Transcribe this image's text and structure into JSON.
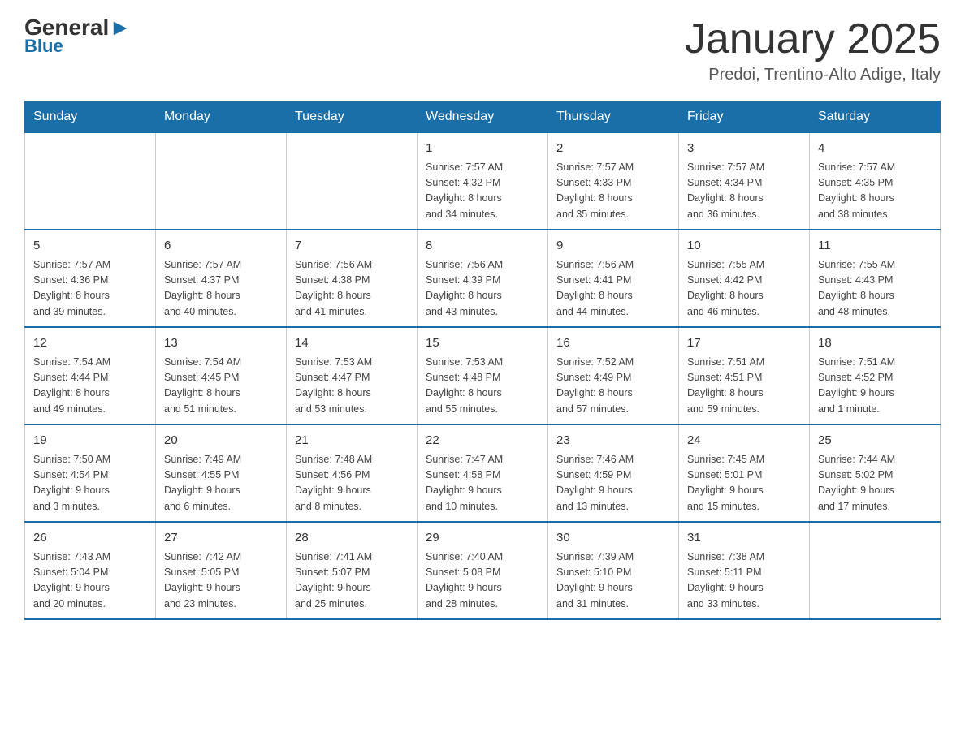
{
  "header": {
    "logo_top": "General",
    "logo_bottom": "Blue",
    "page_title": "January 2025",
    "subtitle": "Predoi, Trentino-Alto Adige, Italy"
  },
  "days_of_week": [
    "Sunday",
    "Monday",
    "Tuesday",
    "Wednesday",
    "Thursday",
    "Friday",
    "Saturday"
  ],
  "weeks": [
    [
      {
        "day": "",
        "info": ""
      },
      {
        "day": "",
        "info": ""
      },
      {
        "day": "",
        "info": ""
      },
      {
        "day": "1",
        "info": "Sunrise: 7:57 AM\nSunset: 4:32 PM\nDaylight: 8 hours\nand 34 minutes."
      },
      {
        "day": "2",
        "info": "Sunrise: 7:57 AM\nSunset: 4:33 PM\nDaylight: 8 hours\nand 35 minutes."
      },
      {
        "day": "3",
        "info": "Sunrise: 7:57 AM\nSunset: 4:34 PM\nDaylight: 8 hours\nand 36 minutes."
      },
      {
        "day": "4",
        "info": "Sunrise: 7:57 AM\nSunset: 4:35 PM\nDaylight: 8 hours\nand 38 minutes."
      }
    ],
    [
      {
        "day": "5",
        "info": "Sunrise: 7:57 AM\nSunset: 4:36 PM\nDaylight: 8 hours\nand 39 minutes."
      },
      {
        "day": "6",
        "info": "Sunrise: 7:57 AM\nSunset: 4:37 PM\nDaylight: 8 hours\nand 40 minutes."
      },
      {
        "day": "7",
        "info": "Sunrise: 7:56 AM\nSunset: 4:38 PM\nDaylight: 8 hours\nand 41 minutes."
      },
      {
        "day": "8",
        "info": "Sunrise: 7:56 AM\nSunset: 4:39 PM\nDaylight: 8 hours\nand 43 minutes."
      },
      {
        "day": "9",
        "info": "Sunrise: 7:56 AM\nSunset: 4:41 PM\nDaylight: 8 hours\nand 44 minutes."
      },
      {
        "day": "10",
        "info": "Sunrise: 7:55 AM\nSunset: 4:42 PM\nDaylight: 8 hours\nand 46 minutes."
      },
      {
        "day": "11",
        "info": "Sunrise: 7:55 AM\nSunset: 4:43 PM\nDaylight: 8 hours\nand 48 minutes."
      }
    ],
    [
      {
        "day": "12",
        "info": "Sunrise: 7:54 AM\nSunset: 4:44 PM\nDaylight: 8 hours\nand 49 minutes."
      },
      {
        "day": "13",
        "info": "Sunrise: 7:54 AM\nSunset: 4:45 PM\nDaylight: 8 hours\nand 51 minutes."
      },
      {
        "day": "14",
        "info": "Sunrise: 7:53 AM\nSunset: 4:47 PM\nDaylight: 8 hours\nand 53 minutes."
      },
      {
        "day": "15",
        "info": "Sunrise: 7:53 AM\nSunset: 4:48 PM\nDaylight: 8 hours\nand 55 minutes."
      },
      {
        "day": "16",
        "info": "Sunrise: 7:52 AM\nSunset: 4:49 PM\nDaylight: 8 hours\nand 57 minutes."
      },
      {
        "day": "17",
        "info": "Sunrise: 7:51 AM\nSunset: 4:51 PM\nDaylight: 8 hours\nand 59 minutes."
      },
      {
        "day": "18",
        "info": "Sunrise: 7:51 AM\nSunset: 4:52 PM\nDaylight: 9 hours\nand 1 minute."
      }
    ],
    [
      {
        "day": "19",
        "info": "Sunrise: 7:50 AM\nSunset: 4:54 PM\nDaylight: 9 hours\nand 3 minutes."
      },
      {
        "day": "20",
        "info": "Sunrise: 7:49 AM\nSunset: 4:55 PM\nDaylight: 9 hours\nand 6 minutes."
      },
      {
        "day": "21",
        "info": "Sunrise: 7:48 AM\nSunset: 4:56 PM\nDaylight: 9 hours\nand 8 minutes."
      },
      {
        "day": "22",
        "info": "Sunrise: 7:47 AM\nSunset: 4:58 PM\nDaylight: 9 hours\nand 10 minutes."
      },
      {
        "day": "23",
        "info": "Sunrise: 7:46 AM\nSunset: 4:59 PM\nDaylight: 9 hours\nand 13 minutes."
      },
      {
        "day": "24",
        "info": "Sunrise: 7:45 AM\nSunset: 5:01 PM\nDaylight: 9 hours\nand 15 minutes."
      },
      {
        "day": "25",
        "info": "Sunrise: 7:44 AM\nSunset: 5:02 PM\nDaylight: 9 hours\nand 17 minutes."
      }
    ],
    [
      {
        "day": "26",
        "info": "Sunrise: 7:43 AM\nSunset: 5:04 PM\nDaylight: 9 hours\nand 20 minutes."
      },
      {
        "day": "27",
        "info": "Sunrise: 7:42 AM\nSunset: 5:05 PM\nDaylight: 9 hours\nand 23 minutes."
      },
      {
        "day": "28",
        "info": "Sunrise: 7:41 AM\nSunset: 5:07 PM\nDaylight: 9 hours\nand 25 minutes."
      },
      {
        "day": "29",
        "info": "Sunrise: 7:40 AM\nSunset: 5:08 PM\nDaylight: 9 hours\nand 28 minutes."
      },
      {
        "day": "30",
        "info": "Sunrise: 7:39 AM\nSunset: 5:10 PM\nDaylight: 9 hours\nand 31 minutes."
      },
      {
        "day": "31",
        "info": "Sunrise: 7:38 AM\nSunset: 5:11 PM\nDaylight: 9 hours\nand 33 minutes."
      },
      {
        "day": "",
        "info": ""
      }
    ]
  ]
}
